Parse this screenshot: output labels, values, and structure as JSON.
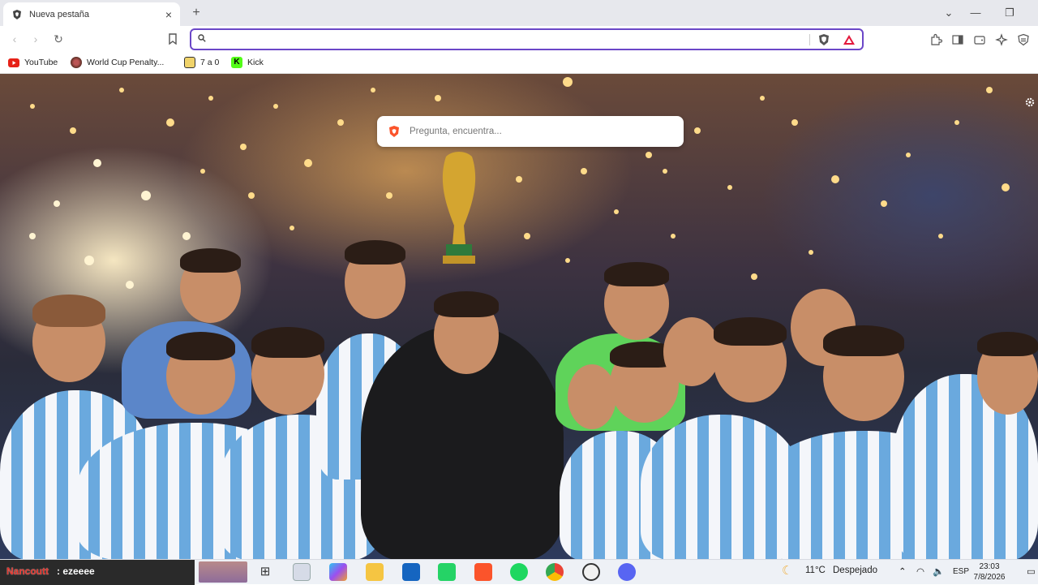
{
  "tabs": [
    {
      "title": "Nueva pestaña"
    }
  ],
  "address_bar": {
    "value": "",
    "placeholder": ""
  },
  "bookmarks": [
    {
      "label": "YouTube",
      "icon": "youtube-icon",
      "color": "#e62117"
    },
    {
      "label": "World Cup Penalty...",
      "icon": "worldcup-icon",
      "color": "#7a3b2e"
    },
    {
      "label": "7 a 0",
      "icon": "7a0-icon",
      "color": "#f0d36a"
    },
    {
      "label": "Kick",
      "icon": "kick-icon",
      "color": "#53fc18"
    }
  ],
  "search": {
    "placeholder": "Pregunta, encuentra..."
  },
  "overlay": {
    "user": "Nancoutt",
    "message": ": ezeeee"
  },
  "taskbar_apps": [
    {
      "name": "task-view-icon"
    },
    {
      "name": "store-icon"
    },
    {
      "name": "copilot-icon"
    },
    {
      "name": "file-explorer-icon"
    },
    {
      "name": "outlook-icon"
    },
    {
      "name": "whatsapp-icon"
    },
    {
      "name": "brave-icon"
    },
    {
      "name": "spotify-icon"
    },
    {
      "name": "chrome-icon"
    },
    {
      "name": "recording-icon"
    },
    {
      "name": "discord-icon"
    }
  ],
  "weather": {
    "temp": "11°C",
    "condition": "Despejado"
  },
  "tray": {
    "language": "ESP"
  },
  "clock": {
    "time": "23:03",
    "date": "7/8/2026"
  },
  "colors": {
    "accent": "#6b47c8",
    "brave": "#fb542b"
  }
}
